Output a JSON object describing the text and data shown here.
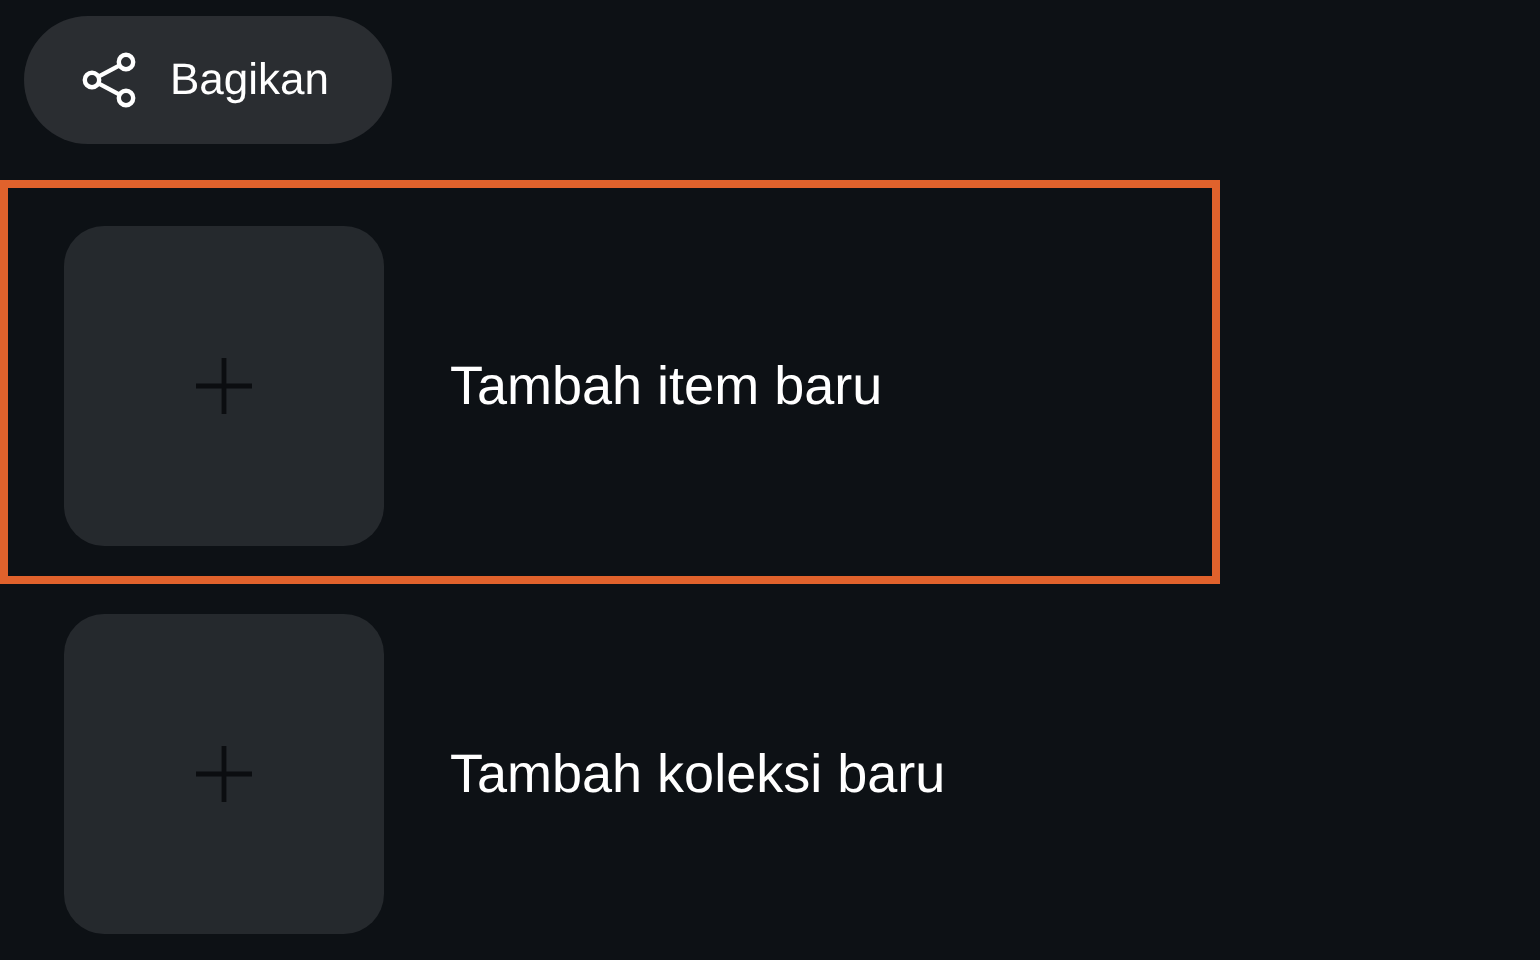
{
  "share_button": {
    "label": "Bagikan"
  },
  "items": [
    {
      "label": "Tambah item baru",
      "highlighted": true
    },
    {
      "label": "Tambah koleksi baru",
      "highlighted": false
    }
  ]
}
